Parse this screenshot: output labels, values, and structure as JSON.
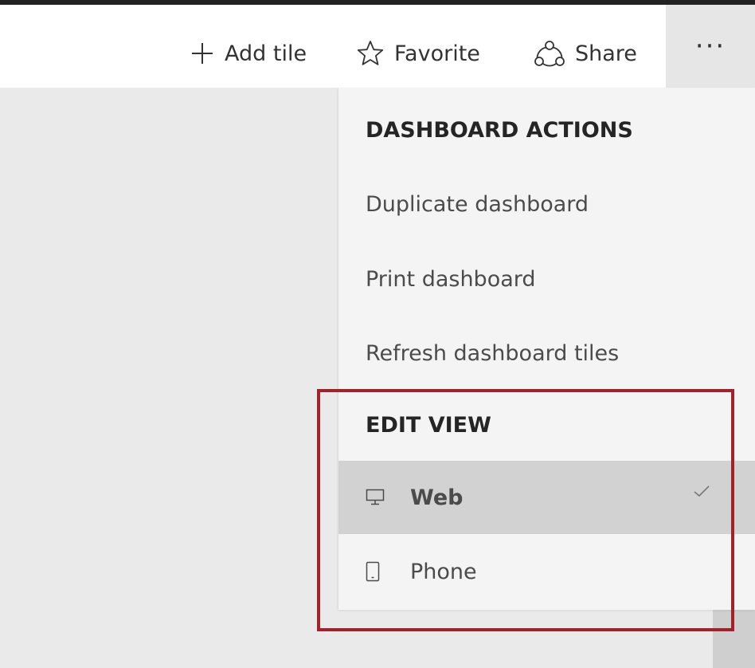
{
  "toolbar": {
    "add_tile_label": "Add tile",
    "favorite_label": "Favorite",
    "share_label": "Share",
    "more_label": "···"
  },
  "menu": {
    "dashboard_actions_header": "DASHBOARD ACTIONS",
    "items": [
      {
        "label": "Duplicate dashboard"
      },
      {
        "label": "Print dashboard"
      },
      {
        "label": "Refresh dashboard tiles"
      }
    ],
    "edit_view_header": "EDIT VIEW",
    "views": [
      {
        "label": "Web",
        "icon": "monitor-icon",
        "selected": true
      },
      {
        "label": "Phone",
        "icon": "phone-icon",
        "selected": false
      }
    ]
  },
  "colors": {
    "highlight_border": "#a3212a",
    "menu_background": "#f4f4f4",
    "selected_background": "#d2d2d2",
    "canvas_background": "#eaeaea"
  }
}
